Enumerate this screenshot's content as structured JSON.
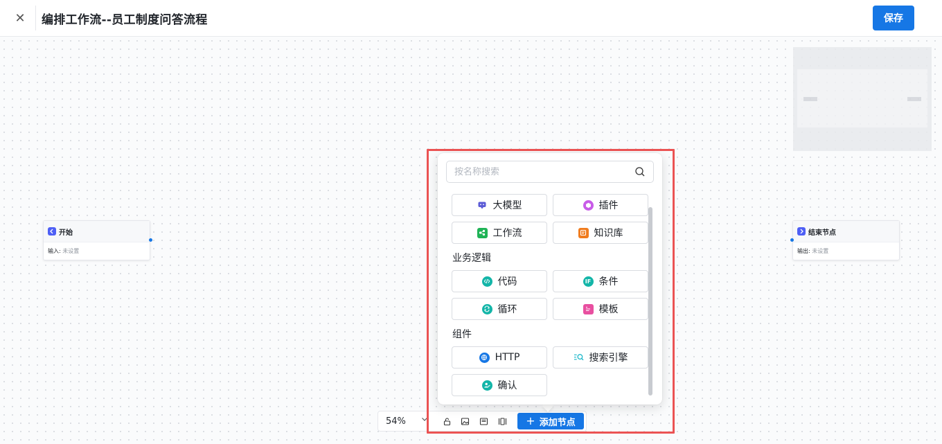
{
  "header": {
    "close_icon": "close-icon",
    "title": "编排工作流--员工制度问答流程",
    "save_label": "保存"
  },
  "canvas": {
    "start_node": {
      "title": "开始",
      "field_label": "输入:",
      "field_value": "未设置"
    },
    "end_node": {
      "title": "结束节点",
      "field_label": "输出:",
      "field_value": "未设置"
    }
  },
  "toolbar": {
    "zoom": "54%",
    "tools": [
      "lock-icon",
      "image-icon",
      "fit-screen-icon",
      "layout-icon"
    ],
    "add_node_label": "添加节点"
  },
  "popup": {
    "search_placeholder": "按名称搜索",
    "basic_nodes": [
      {
        "label": "大模型",
        "icon": "llm-chat-icon",
        "color": "#5b5bd6"
      },
      {
        "label": "插件",
        "icon": "plugin-cube-icon",
        "color": "#c85ce8"
      },
      {
        "label": "工作流",
        "icon": "workflow-icon",
        "color": "#1fb356"
      },
      {
        "label": "知识库",
        "icon": "knowledge-base-icon",
        "color": "#f07c1e"
      }
    ],
    "section_logic": "业务逻辑",
    "logic_nodes": [
      {
        "label": "代码",
        "icon": "code-icon",
        "color": "#13b5a8"
      },
      {
        "label": "条件",
        "icon": "condition-if-icon",
        "color": "#13b5a8"
      },
      {
        "label": "循环",
        "icon": "loop-icon",
        "color": "#13b5a8"
      },
      {
        "label": "模板",
        "icon": "template-icon",
        "color": "#e84fa0"
      }
    ],
    "section_component": "组件",
    "component_nodes": [
      {
        "label": "HTTP",
        "icon": "http-globe-icon",
        "color": "#1677e5"
      },
      {
        "label": "搜索引擎",
        "icon": "search-engine-icon",
        "color": "#13b5c8"
      },
      {
        "label": "确认",
        "icon": "confirm-user-icon",
        "color": "#13b5a8"
      }
    ]
  }
}
